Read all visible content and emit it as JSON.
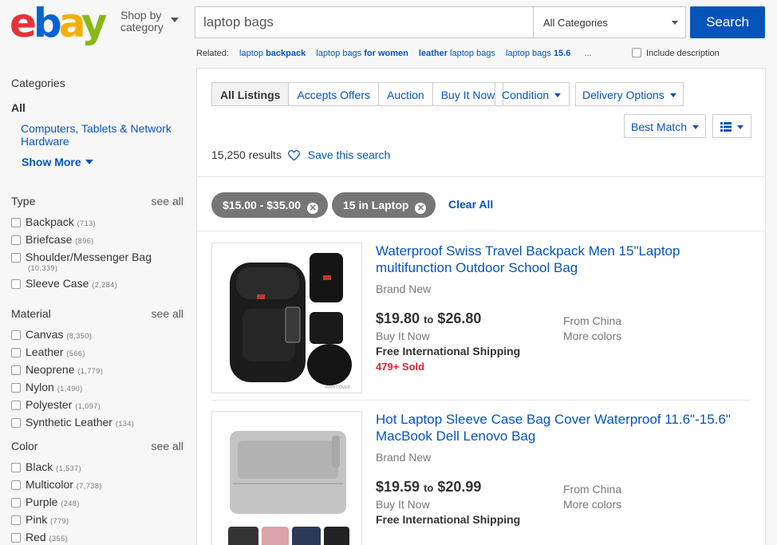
{
  "header": {
    "logo": [
      "e",
      "b",
      "a",
      "y"
    ],
    "shop_by_line1": "Shop by",
    "shop_by_line2": "category",
    "search_value": "laptop bags",
    "category": "All Categories",
    "search_label": "Search"
  },
  "related": {
    "label": "Related:",
    "links": [
      {
        "pre": "laptop ",
        "kw": "backpack",
        "post": ""
      },
      {
        "pre": "laptop bags ",
        "kw": "for women",
        "post": ""
      },
      {
        "pre": "",
        "kw": "leather",
        "post": " laptop bags"
      },
      {
        "pre": "laptop bags ",
        "kw": "15.6",
        "post": ""
      }
    ],
    "dots": "...",
    "include_description": "Include description"
  },
  "sidebar": {
    "categories_title": "Categories",
    "all": "All",
    "category_link": "Computers, Tablets & Network Hardware",
    "show_more": "Show More",
    "see_all": "see all",
    "type": {
      "title": "Type",
      "options": [
        {
          "label": "Backpack",
          "count": "(713)"
        },
        {
          "label": "Briefcase",
          "count": "(896)"
        },
        {
          "label": "Shoulder/Messenger Bag",
          "count": "(10,339)"
        },
        {
          "label": "Sleeve Case",
          "count": "(2,284)"
        }
      ]
    },
    "material": {
      "title": "Material",
      "options": [
        {
          "label": "Canvas",
          "count": "(8,350)"
        },
        {
          "label": "Leather",
          "count": "(566)"
        },
        {
          "label": "Neoprene",
          "count": "(1,779)"
        },
        {
          "label": "Nylon",
          "count": "(1,490)"
        },
        {
          "label": "Polyester",
          "count": "(1,097)"
        },
        {
          "label": "Synthetic Leather",
          "count": "(134)"
        }
      ]
    },
    "color": {
      "title": "Color",
      "options": [
        {
          "label": "Black",
          "count": "(1,537)"
        },
        {
          "label": "Multicolor",
          "count": "(7,738)"
        },
        {
          "label": "Purple",
          "count": "(248)"
        },
        {
          "label": "Pink",
          "count": "(779)"
        },
        {
          "label": "Red",
          "count": "(355)"
        }
      ]
    }
  },
  "toolbar": {
    "tabs": [
      "All Listings",
      "Accepts Offers",
      "Auction",
      "Buy It Now"
    ],
    "condition": "Condition",
    "delivery": "Delivery Options",
    "sort": "Best Match",
    "results_count": "15,250 results",
    "save_search": "Save this search"
  },
  "filters": {
    "chips": [
      "$15.00 - $35.00",
      "15 in Laptop"
    ],
    "clear_all": "Clear All"
  },
  "items": [
    {
      "title": "Waterproof Swiss Travel Backpack Men 15\"Laptop multifunction Outdoor School Bag",
      "condition": "Brand New",
      "price_low": "$19.80",
      "price_to": "to",
      "price_high": "$26.80",
      "format": "Buy It Now",
      "shipping": "Free International Shipping",
      "sold": "479+ Sold",
      "from": "From China",
      "more": "More colors",
      "image_text": "RAIN COVER"
    },
    {
      "title": "Hot Laptop Sleeve Case Bag Cover Waterproof 11.6\"-15.6\" MacBook Dell Lenovo Bag",
      "condition": "Brand New",
      "price_low": "$19.59",
      "price_to": "to",
      "price_high": "$20.99",
      "format": "Buy It Now",
      "shipping": "Free International Shipping",
      "from": "From China",
      "more": "More colors"
    }
  ],
  "colors": {
    "link": "#0654ba",
    "search_button": "#0654ba",
    "chip": "#767676",
    "sold": "#dd1e31"
  }
}
